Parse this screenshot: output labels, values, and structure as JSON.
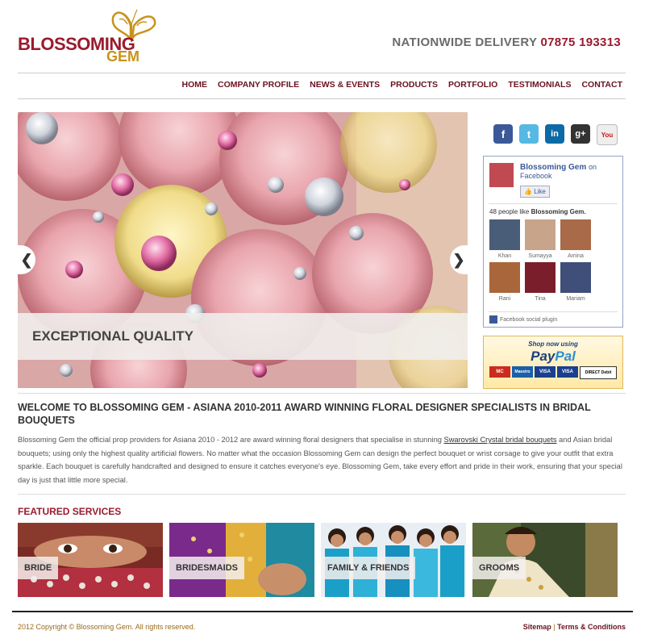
{
  "header": {
    "logo_line1": "BLOSSOMING",
    "logo_line2": "GEM",
    "delivery_label": "NATIONWIDE DELIVERY",
    "delivery_phone": "07875 193313"
  },
  "nav": [
    "HOME",
    "COMPANY PROFILE",
    "NEWS & EVENTS",
    "PRODUCTS",
    "PORTFOLIO",
    "TESTIMONIALS",
    "CONTACT"
  ],
  "slider": {
    "caption": "EXCEPTIONAL QUALITY",
    "prev_icon": "chevron-left-icon",
    "next_icon": "chevron-right-icon"
  },
  "social": {
    "icons": [
      "facebook-icon",
      "twitter-icon",
      "linkedin-icon",
      "googleplus-icon",
      "youtube-icon"
    ],
    "glyphs": [
      "f",
      "t",
      "in",
      "g+",
      "You"
    ]
  },
  "facebook_box": {
    "page_name": "Blossoming Gem",
    "on_text": "on",
    "platform": "Facebook",
    "like_label": "Like",
    "count_prefix": "48 people like",
    "count_page": "Blossoming Gem.",
    "fans": [
      {
        "name": "Khan",
        "color": "#4a5d78"
      },
      {
        "name": "Sumayya",
        "color": "#c7a48a"
      },
      {
        "name": "Amina",
        "color": "#a86a48"
      },
      {
        "name": "Rani",
        "color": "#a9663a"
      },
      {
        "name": "Tina",
        "color": "#7a1e2c"
      },
      {
        "name": "Mariam",
        "color": "#3f4f7a"
      }
    ],
    "plugin_label": "Facebook social plugin"
  },
  "paypal": {
    "shop_text": "Shop now using",
    "pay": "Pay",
    "pal": "Pal",
    "cards": [
      "MC",
      "Maestro",
      "VISA",
      "VISA",
      "DIRECT Debit"
    ]
  },
  "welcome": {
    "title": "WELCOME TO BLOSSOMING GEM - ASIANA 2010-2011 AWARD WINNING FLORAL DESIGNER SPECIALISTS IN BRIDAL BOUQUETS",
    "body_before_link": "Blossoming Gem the official prop providers for Asiana 2010 - 2012 are award winning floral designers that specialise in stunning ",
    "link_text": "Swarovski Crystal bridal bouquets",
    "body_after_link": " and Asian bridal bouquets; using only the highest quality artificial flowers. No matter what the occasion Blossoming Gem can design the perfect bouquet or wrist corsage to give your outfit that extra sparkle. Each bouquet is carefully handcrafted and designed to ensure it catches everyone's eye. Blossoming Gem, take every effort and pride in their work, ensuring that your special day is just that little more special."
  },
  "featured": {
    "title": "FEATURED SERVICES",
    "items": [
      {
        "label": "BRIDE"
      },
      {
        "label": "BRIDESMAIDS"
      },
      {
        "label": "FAMILY & FRIENDS"
      },
      {
        "label": "GROOMS"
      }
    ]
  },
  "footer": {
    "copyright": "2012 Copyright © Blossoming Gem. All rights reserved.",
    "sitemap": "Sitemap",
    "separator": "|",
    "terms": "Terms & Conditions"
  },
  "colors": {
    "brand": "#9a1b2e",
    "gold": "#c9921a",
    "nav": "#6a1220"
  }
}
